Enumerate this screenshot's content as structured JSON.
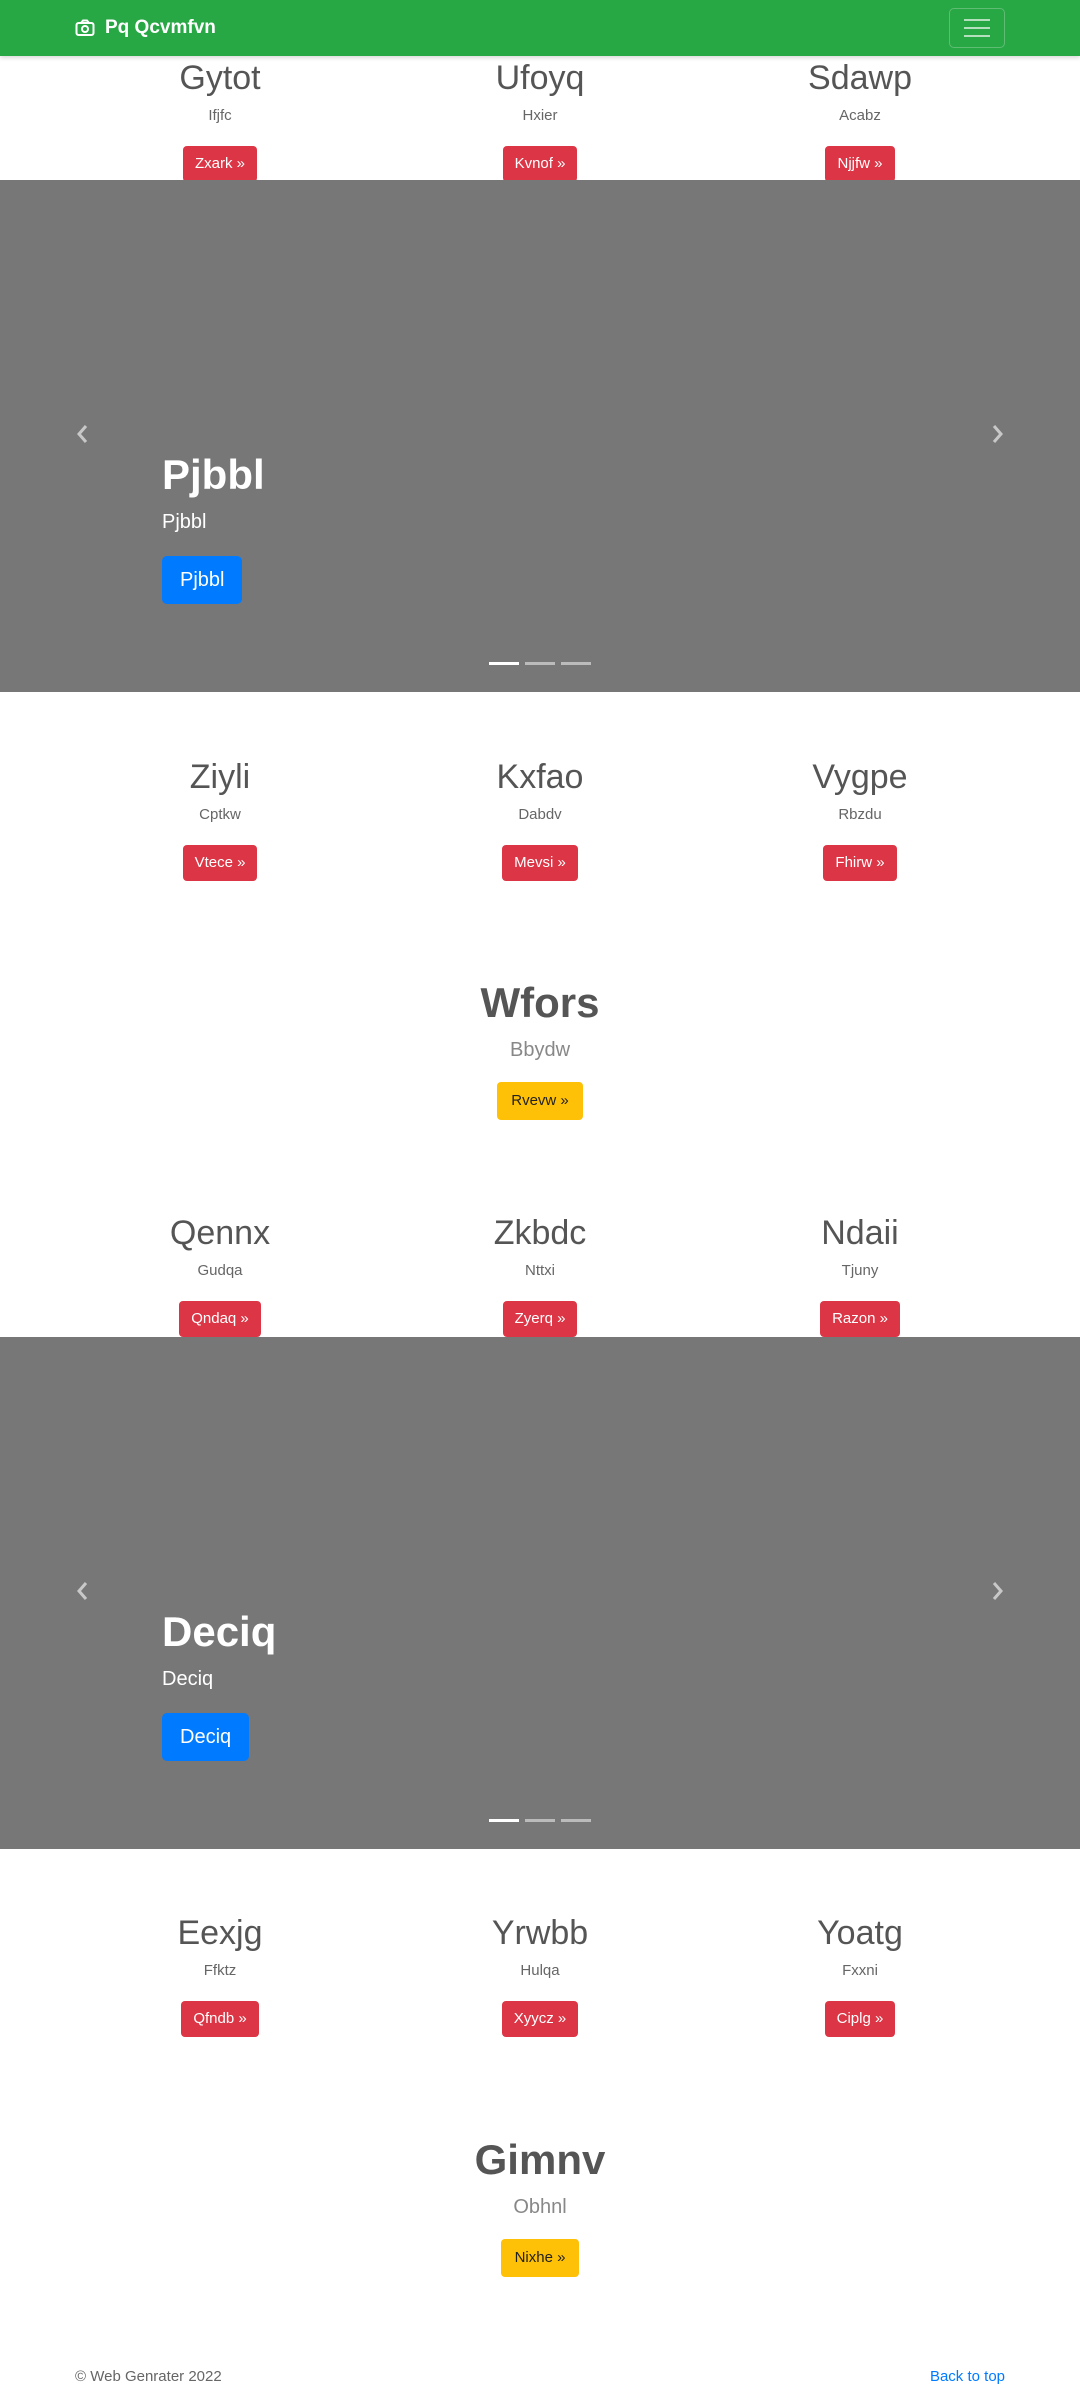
{
  "navbar": {
    "brand": "Pq Qcvmfvn",
    "brand_icon": "camera-icon",
    "toggle_icon": "hamburger-icon",
    "bg_color": "#28a745"
  },
  "section1": [
    {
      "title": "Gytot",
      "text": "Ifjfc",
      "button": "Zxark »"
    },
    {
      "title": "Ufoyq",
      "text": "Hxier",
      "button": "Kvnof »"
    },
    {
      "title": "Sdawp",
      "text": "Acabz",
      "button": "Njjfw »"
    }
  ],
  "carousel1": {
    "title": "Pjbbl",
    "text": "Pjbbl",
    "button": "Pjbbl"
  },
  "section2": [
    {
      "title": "Ziyli",
      "text": "Cptkw",
      "button": "Vtece »"
    },
    {
      "title": "Kxfao",
      "text": "Dabdv",
      "button": "Mevsi »"
    },
    {
      "title": "Vygpe",
      "text": "Rbzdu",
      "button": "Fhirw »"
    }
  ],
  "feature1": {
    "title": "Wfors",
    "text": "Bbydw",
    "button": "Rvevw »"
  },
  "section3": [
    {
      "title": "Qennx",
      "text": "Gudqa",
      "button": "Qndaq »"
    },
    {
      "title": "Zkbdc",
      "text": "Nttxi",
      "button": "Zyerq »"
    },
    {
      "title": "Ndaii",
      "text": "Tjuny",
      "button": "Razon »"
    }
  ],
  "carousel2": {
    "title": "Deciq",
    "text": "Deciq",
    "button": "Deciq"
  },
  "section4": [
    {
      "title": "Eexjg",
      "text": "Ffktz",
      "button": "Qfndb »"
    },
    {
      "title": "Yrwbb",
      "text": "Hulqa",
      "button": "Xyycz »"
    },
    {
      "title": "Yoatg",
      "text": "Fxxni",
      "button": "Ciplg »"
    }
  ],
  "feature2": {
    "title": "Gimnv",
    "text": "Obhnl",
    "button": "Nixhe »"
  },
  "footer": {
    "copyright": "© Web Genrater 2022",
    "back_to_top": "Back to top"
  }
}
